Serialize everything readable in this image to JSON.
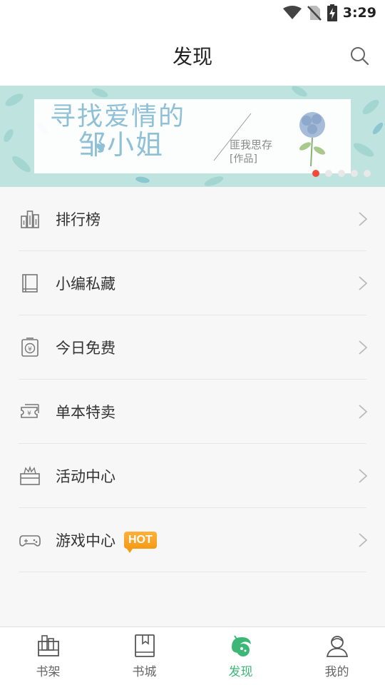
{
  "status_bar": {
    "time": "3:29"
  },
  "header": {
    "title": "发现"
  },
  "banner": {
    "title_line1": "寻找爱情的",
    "title_line2": "邹小姐",
    "author": "匪我思存",
    "works": "[作品]",
    "slide_count": 5,
    "active_slide": 1,
    "colors": {
      "background": "#bfe3df",
      "text": "#8fc0d6"
    }
  },
  "menu": {
    "items": [
      {
        "label": "排行榜",
        "icon": "ranking-icon"
      },
      {
        "label": "小编私藏",
        "icon": "book-icon"
      },
      {
        "label": "今日免费",
        "icon": "free-coupon-icon"
      },
      {
        "label": "单本特卖",
        "icon": "ticket-icon"
      },
      {
        "label": "活动中心",
        "icon": "gift-box-icon"
      },
      {
        "label": "游戏中心",
        "icon": "gamepad-icon",
        "badge": "HOT"
      }
    ]
  },
  "bottom_nav": {
    "tabs": [
      {
        "label": "书架",
        "icon": "bookshelf-icon"
      },
      {
        "label": "书城",
        "icon": "bookstore-icon"
      },
      {
        "label": "发现",
        "icon": "discover-icon",
        "active": true
      },
      {
        "label": "我的",
        "icon": "profile-icon"
      }
    ],
    "colors": {
      "active": "#3cb776",
      "inactive": "#666666"
    }
  }
}
